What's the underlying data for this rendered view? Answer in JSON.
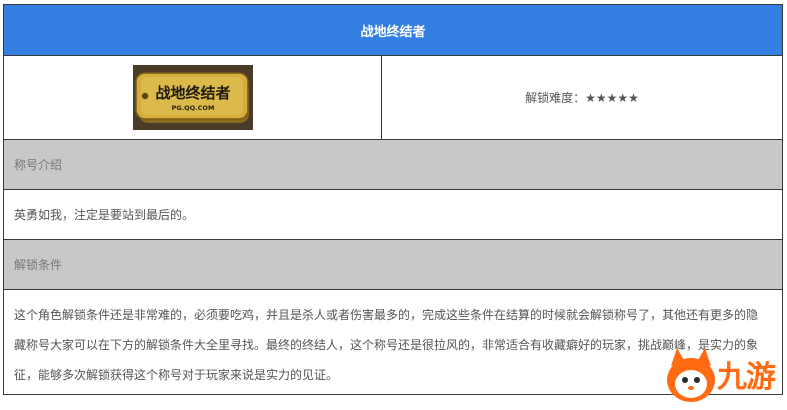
{
  "header": {
    "title": "战地终结者"
  },
  "badge": {
    "logo_text": "战地终结者",
    "logo_subtext": "PG.QQ.COM"
  },
  "difficulty": {
    "label": "解锁难度：",
    "stars": "★★★★★",
    "rating": 5,
    "max": 5
  },
  "intro": {
    "heading": "称号介绍",
    "text": "英勇如我，注定是要站到最后的。"
  },
  "unlock": {
    "heading": "解锁条件",
    "text": "这个角色解锁条件还是非常难的，必须要吃鸡，并且是杀人或者伤害最多的，完成这些条件在结算的时候就会解锁称号了，其他还有更多的隐藏称号大家可以在下方的解锁条件大全里寻找。最终的终结人，这个称号还是很拉风的，非常适合有收藏癖好的玩家，挑战巅峰，是实力的象征，能够多次解锁获得这个称号对于玩家来说是实力的见证。"
  },
  "watermark": {
    "text": "九游"
  },
  "colors": {
    "header_bg": "#3380e2",
    "section_bg": "#c8c8c8",
    "watermark": "#ff6a13",
    "badge_gold": "#c9a233"
  }
}
